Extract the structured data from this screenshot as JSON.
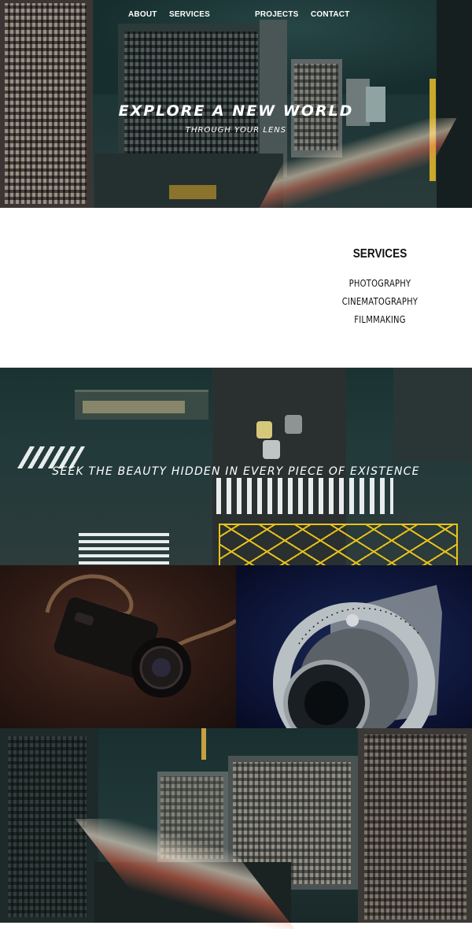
{
  "nav": {
    "items": [
      {
        "label": "ABOUT"
      },
      {
        "label": "SERVICES"
      },
      {
        "label": "PROJECTS"
      },
      {
        "label": "CONTACT"
      }
    ]
  },
  "hero": {
    "title": "EXPLORE A NEW WORLD",
    "subtitle": "THROUGH YOUR LENS"
  },
  "services": {
    "title": "SERVICES",
    "items": [
      "PHOTOGRAPHY",
      "CINEMATOGRAPHY",
      "FILMMAKING"
    ]
  },
  "crossing": {
    "quote": "SEEK THE BEAUTY HIDDEN IN EVERY PIECE OF EXISTENCE"
  },
  "colors": {
    "hero_teal": "#1c3535",
    "text_white": "#ffffff",
    "crossing_yellow": "#e8c21a",
    "camera_left_brown": "#4a2c22",
    "camera_right_navy": "#1a2a55"
  }
}
